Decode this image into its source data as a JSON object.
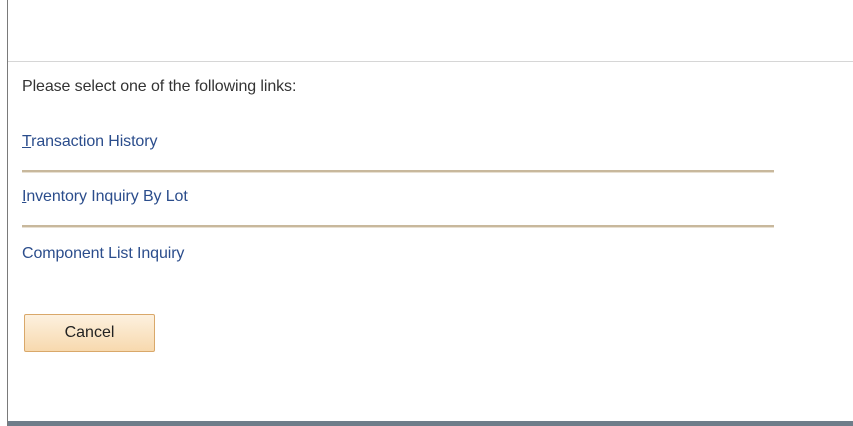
{
  "prompt": "Please select one of the following links:",
  "links": [
    {
      "accesskey": "T",
      "rest": "ransaction History"
    },
    {
      "accesskey": "I",
      "rest": "nventory Inquiry By Lot"
    },
    {
      "accesskey": "",
      "rest": "Component List Inquiry"
    }
  ],
  "cancel_label": "Cancel",
  "colors": {
    "link": "#2b4d8c",
    "separator": "#c8b89c",
    "button_fill": "#f7d9ae",
    "button_border": "#d9a86a",
    "bottom_bar": "#6f7d8a"
  }
}
